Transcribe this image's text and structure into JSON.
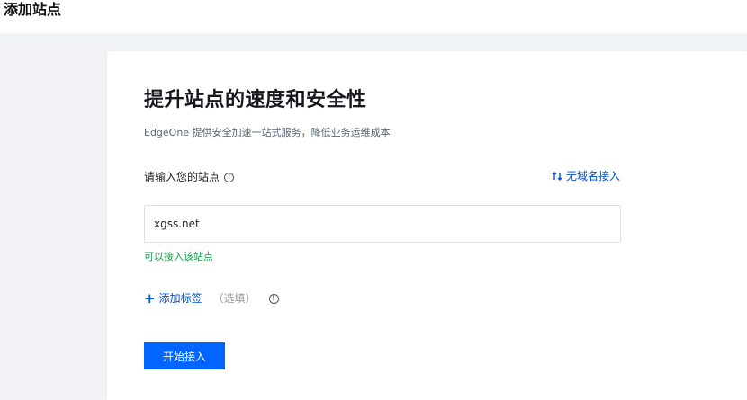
{
  "header": {
    "title": "添加站点"
  },
  "card": {
    "headline": "提升站点的速度和安全性",
    "subtitle": "EdgeOne 提供安全加速一站式服务，降低业务运维成本",
    "site_field": {
      "label": "请输入您的站点",
      "value": "xgss.net",
      "status": "可以接入该站点"
    },
    "no_domain_link": "无域名接入",
    "add_tag": {
      "label": "添加标签",
      "optional": "（选填）"
    },
    "start_button": "开始接入"
  },
  "colors": {
    "accent": "#0052d9",
    "button": "#0066ff",
    "success": "#14a14d",
    "background": "#f2f3f6"
  },
  "icons": {
    "info": "info-circle-icon",
    "swap": "swap-icon",
    "plus": "plus-icon"
  }
}
